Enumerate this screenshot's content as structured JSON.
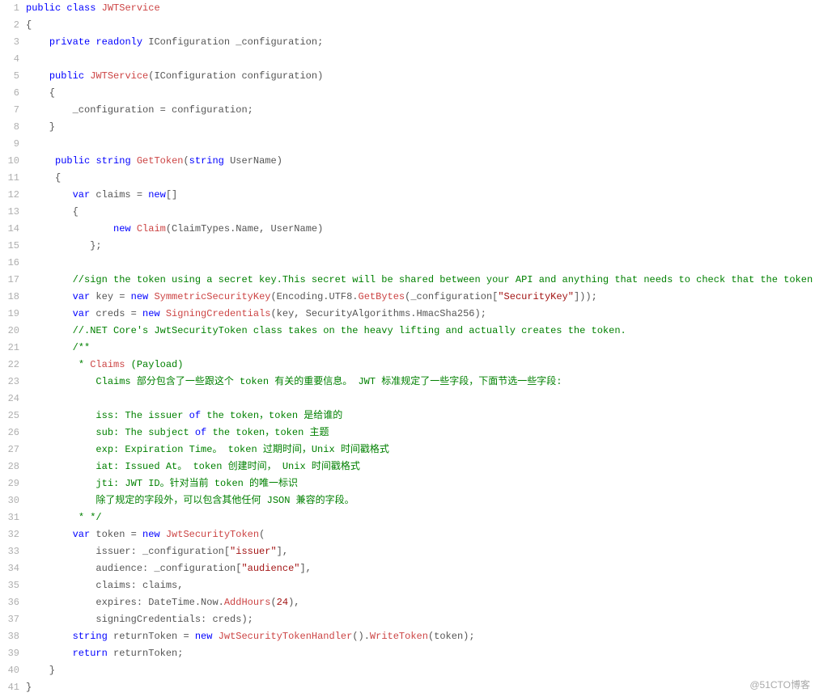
{
  "watermark": "@51CTO博客",
  "lines": [
    {
      "n": "1",
      "tokens": [
        [
          "kw",
          "public"
        ],
        [
          "txt",
          " "
        ],
        [
          "kw",
          "class"
        ],
        [
          "txt",
          " "
        ],
        [
          "cls",
          "JWTService"
        ]
      ]
    },
    {
      "n": "2",
      "tokens": [
        [
          "txt",
          "{"
        ]
      ]
    },
    {
      "n": "3",
      "tokens": [
        [
          "txt",
          "    "
        ],
        [
          "kw",
          "private"
        ],
        [
          "txt",
          " "
        ],
        [
          "kw",
          "readonly"
        ],
        [
          "txt",
          " IConfiguration _configuration;"
        ]
      ]
    },
    {
      "n": "4",
      "tokens": [
        [
          "txt",
          ""
        ]
      ]
    },
    {
      "n": "5",
      "tokens": [
        [
          "txt",
          "    "
        ],
        [
          "kw",
          "public"
        ],
        [
          "txt",
          " "
        ],
        [
          "cls",
          "JWTService"
        ],
        [
          "txt",
          "(IConfiguration configuration)"
        ]
      ]
    },
    {
      "n": "6",
      "tokens": [
        [
          "txt",
          "    {"
        ]
      ]
    },
    {
      "n": "7",
      "tokens": [
        [
          "txt",
          "        _configuration = configuration;"
        ]
      ]
    },
    {
      "n": "8",
      "tokens": [
        [
          "txt",
          "    }"
        ]
      ]
    },
    {
      "n": "9",
      "tokens": [
        [
          "txt",
          ""
        ]
      ]
    },
    {
      "n": "10",
      "tokens": [
        [
          "txt",
          "     "
        ],
        [
          "kw",
          "public"
        ],
        [
          "txt",
          " "
        ],
        [
          "kw",
          "string"
        ],
        [
          "txt",
          " "
        ],
        [
          "cls",
          "GetToken"
        ],
        [
          "txt",
          "("
        ],
        [
          "kw",
          "string"
        ],
        [
          "txt",
          " UserName)"
        ]
      ]
    },
    {
      "n": "11",
      "tokens": [
        [
          "txt",
          "     {"
        ]
      ]
    },
    {
      "n": "12",
      "tokens": [
        [
          "txt",
          "        "
        ],
        [
          "kw",
          "var"
        ],
        [
          "txt",
          " claims = "
        ],
        [
          "kw",
          "new"
        ],
        [
          "txt",
          "[]"
        ]
      ]
    },
    {
      "n": "13",
      "tokens": [
        [
          "txt",
          "        {"
        ]
      ]
    },
    {
      "n": "14",
      "tokens": [
        [
          "txt",
          "               "
        ],
        [
          "kw",
          "new"
        ],
        [
          "txt",
          " "
        ],
        [
          "cls",
          "Claim"
        ],
        [
          "txt",
          "(ClaimTypes.Name, UserName)"
        ]
      ]
    },
    {
      "n": "15",
      "tokens": [
        [
          "txt",
          "           };"
        ]
      ]
    },
    {
      "n": "16",
      "tokens": [
        [
          "txt",
          ""
        ]
      ]
    },
    {
      "n": "17",
      "tokens": [
        [
          "txt",
          "        "
        ],
        [
          "cmt",
          "//sign the token using a secret key.This secret will be shared between your API and anything that needs to check that the token is legit."
        ]
      ]
    },
    {
      "n": "18",
      "tokens": [
        [
          "txt",
          "        "
        ],
        [
          "kw",
          "var"
        ],
        [
          "txt",
          " key = "
        ],
        [
          "kw",
          "new"
        ],
        [
          "txt",
          " "
        ],
        [
          "cls",
          "SymmetricSecurityKey"
        ],
        [
          "txt",
          "(Encoding.UTF8."
        ],
        [
          "cls",
          "GetBytes"
        ],
        [
          "txt",
          "(_configuration["
        ],
        [
          "str",
          "\"SecurityKey\""
        ],
        [
          "txt",
          "]));"
        ]
      ]
    },
    {
      "n": "19",
      "tokens": [
        [
          "txt",
          "        "
        ],
        [
          "kw",
          "var"
        ],
        [
          "txt",
          " creds = "
        ],
        [
          "kw",
          "new"
        ],
        [
          "txt",
          " "
        ],
        [
          "cls",
          "SigningCredentials"
        ],
        [
          "txt",
          "(key, SecurityAlgorithms.HmacSha256);"
        ]
      ]
    },
    {
      "n": "20",
      "tokens": [
        [
          "txt",
          "        "
        ],
        [
          "cmt",
          "//.NET Core's JwtSecurityToken class takes on the heavy lifting and actually creates the token."
        ]
      ]
    },
    {
      "n": "21",
      "tokens": [
        [
          "txt",
          "        "
        ],
        [
          "cmt",
          "/**"
        ]
      ]
    },
    {
      "n": "22",
      "tokens": [
        [
          "txt",
          "         "
        ],
        [
          "cmt",
          "* "
        ],
        [
          "cls",
          "Claims"
        ],
        [
          "cmt",
          " (Payload)"
        ]
      ]
    },
    {
      "n": "23",
      "tokens": [
        [
          "txt",
          "            "
        ],
        [
          "cmt",
          "Claims 部分包含了一些跟这个 token 有关的重要信息。 JWT 标准规定了一些字段，下面节选一些字段:"
        ]
      ]
    },
    {
      "n": "24",
      "tokens": [
        [
          "txt",
          ""
        ]
      ]
    },
    {
      "n": "25",
      "tokens": [
        [
          "txt",
          "            "
        ],
        [
          "cmt",
          "iss: The issuer "
        ],
        [
          "kw",
          "of"
        ],
        [
          "cmt",
          " the token，token 是给谁的"
        ]
      ]
    },
    {
      "n": "26",
      "tokens": [
        [
          "txt",
          "            "
        ],
        [
          "cmt",
          "sub: The subject "
        ],
        [
          "kw",
          "of"
        ],
        [
          "cmt",
          " the token，token 主题"
        ]
      ]
    },
    {
      "n": "27",
      "tokens": [
        [
          "txt",
          "            "
        ],
        [
          "cmt",
          "exp: Expiration Time。 token 过期时间，Unix 时间戳格式"
        ]
      ]
    },
    {
      "n": "28",
      "tokens": [
        [
          "txt",
          "            "
        ],
        [
          "cmt",
          "iat: Issued At。 token 创建时间， Unix 时间戳格式"
        ]
      ]
    },
    {
      "n": "29",
      "tokens": [
        [
          "txt",
          "            "
        ],
        [
          "cmt",
          "jti: JWT ID。针对当前 token 的唯一标识"
        ]
      ]
    },
    {
      "n": "30",
      "tokens": [
        [
          "txt",
          "            "
        ],
        [
          "cmt",
          "除了规定的字段外，可以包含其他任何 JSON 兼容的字段。"
        ]
      ]
    },
    {
      "n": "31",
      "tokens": [
        [
          "txt",
          "         "
        ],
        [
          "cmt",
          "* */"
        ]
      ]
    },
    {
      "n": "32",
      "tokens": [
        [
          "txt",
          "        "
        ],
        [
          "kw",
          "var"
        ],
        [
          "txt",
          " token = "
        ],
        [
          "kw",
          "new"
        ],
        [
          "txt",
          " "
        ],
        [
          "cls",
          "JwtSecurityToken"
        ],
        [
          "txt",
          "("
        ]
      ]
    },
    {
      "n": "33",
      "tokens": [
        [
          "txt",
          "            issuer: _configuration["
        ],
        [
          "str",
          "\"issuer\""
        ],
        [
          "txt",
          "],"
        ]
      ]
    },
    {
      "n": "34",
      "tokens": [
        [
          "txt",
          "            audience: _configuration["
        ],
        [
          "str",
          "\"audience\""
        ],
        [
          "txt",
          "],"
        ]
      ]
    },
    {
      "n": "35",
      "tokens": [
        [
          "txt",
          "            claims: claims,"
        ]
      ]
    },
    {
      "n": "36",
      "tokens": [
        [
          "txt",
          "            expires: DateTime.Now."
        ],
        [
          "cls",
          "AddHours"
        ],
        [
          "txt",
          "("
        ],
        [
          "num",
          "24"
        ],
        [
          "txt",
          "),"
        ]
      ]
    },
    {
      "n": "37",
      "tokens": [
        [
          "txt",
          "            signingCredentials: creds);"
        ]
      ]
    },
    {
      "n": "38",
      "tokens": [
        [
          "txt",
          "        "
        ],
        [
          "kw",
          "string"
        ],
        [
          "txt",
          " returnToken = "
        ],
        [
          "kw",
          "new"
        ],
        [
          "txt",
          " "
        ],
        [
          "cls",
          "JwtSecurityTokenHandler"
        ],
        [
          "txt",
          "()."
        ],
        [
          "cls",
          "WriteToken"
        ],
        [
          "txt",
          "(token);"
        ]
      ]
    },
    {
      "n": "39",
      "tokens": [
        [
          "txt",
          "        "
        ],
        [
          "kw",
          "return"
        ],
        [
          "txt",
          " returnToken;"
        ]
      ]
    },
    {
      "n": "40",
      "tokens": [
        [
          "txt",
          "    }"
        ]
      ]
    },
    {
      "n": "41",
      "tokens": [
        [
          "txt",
          "}"
        ]
      ]
    }
  ]
}
